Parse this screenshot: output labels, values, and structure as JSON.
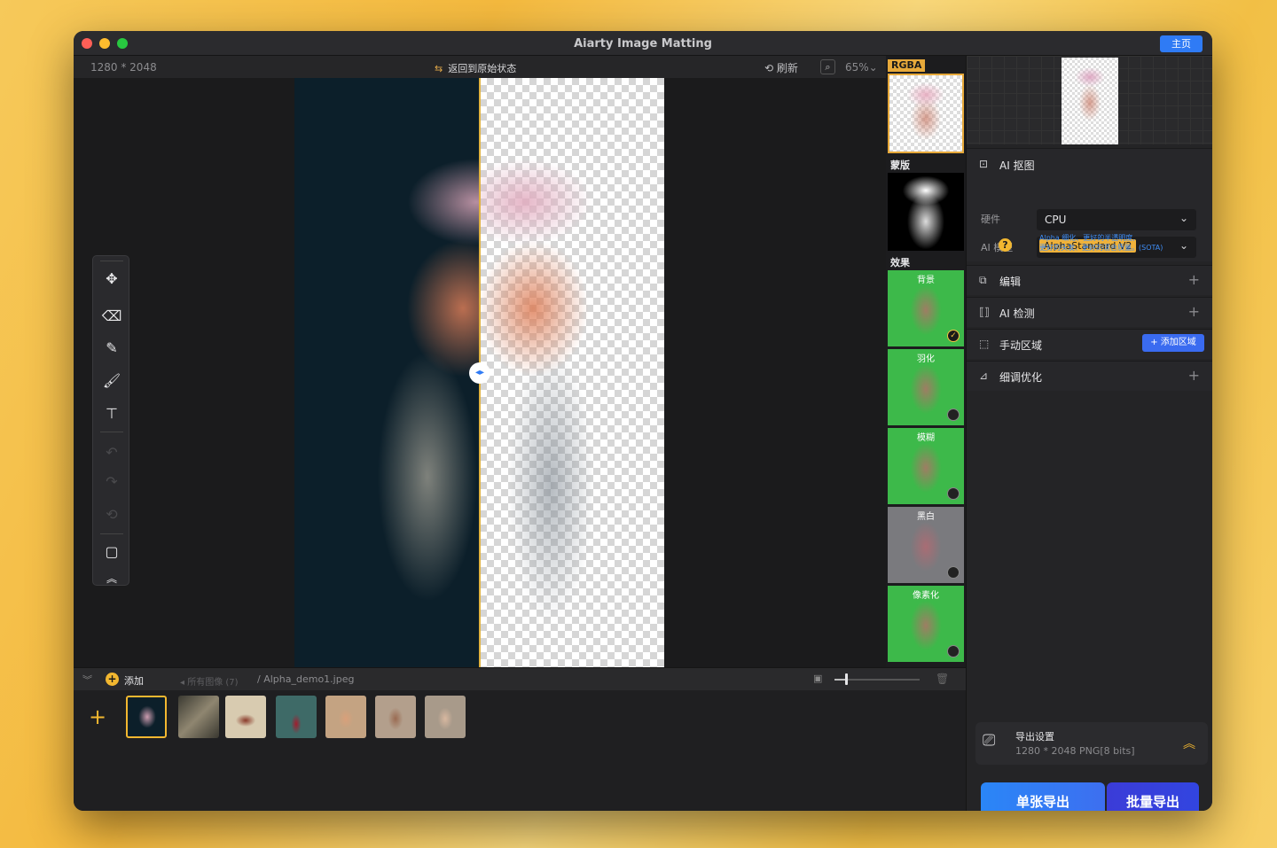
{
  "window": {
    "title": "Aiarty Image Matting",
    "home_label": "主页"
  },
  "canvas_bar": {
    "dimensions": "1280 * 2048",
    "revert_label": "返回到原始状态",
    "refresh_label": "刷新",
    "zoom": "65%"
  },
  "preview_col": {
    "rgba_label": "RGBA",
    "mask_label": "蒙版",
    "effect_label": "效果",
    "effects": [
      {
        "label": "背景",
        "checked": true
      },
      {
        "label": "羽化",
        "checked": false
      },
      {
        "label": "模糊",
        "checked": false
      },
      {
        "label": "黑白",
        "checked": false
      },
      {
        "label": "像素化",
        "checked": false
      }
    ]
  },
  "right_panel": {
    "ai_matting_title": "AI 抠图",
    "hardware_label": "硬件",
    "hardware_value": "CPU",
    "model_label": "AI 模型",
    "model_value": "AlphaStandard  V2",
    "model_desc_line1": "Alpha 细化、更好的半透明度,",
    "model_desc_line2": "更好的头发、更好的混合质量。(SOTA)",
    "edit_title": "编辑",
    "detect_title": "AI 检测",
    "manual_title": "手动区域",
    "add_region_label": "添加区域",
    "refine_title": "细调优化",
    "export_title": "导出设置",
    "export_sub": "1280 * 2048 PNG[8 bits]",
    "single_export": "单张导出",
    "batch_export": "批量导出"
  },
  "strip": {
    "add_label": "添加",
    "all_images": "所有图像 (7)",
    "file_path": "/ Alpha_demo1.jpeg",
    "thumbnail_count": 7
  },
  "colors": {
    "accent": "#2f7bf5",
    "highlight": "#f2b730",
    "panel": "#242426"
  }
}
